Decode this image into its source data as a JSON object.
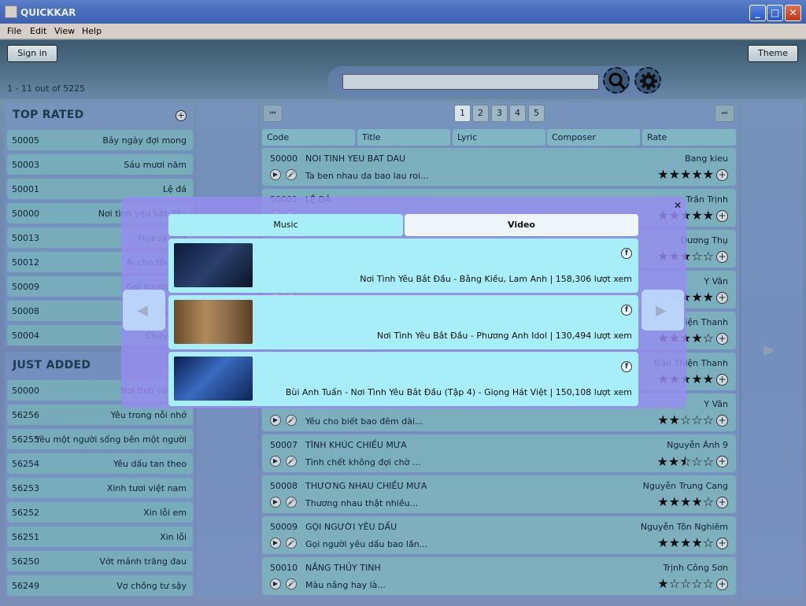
{
  "window": {
    "title": "QUICKKAR",
    "minimize": "_",
    "maximize": "□",
    "close": "✕"
  },
  "menu": [
    "File",
    "Edit",
    "View",
    "Help"
  ],
  "header": {
    "sign_in": "Sign in",
    "theme": "Theme",
    "result_count": "1 - 11 out of 5225",
    "search_placeholder": ""
  },
  "icons": {
    "search": "search-icon",
    "settings": "gear-icon"
  },
  "top_rated": {
    "heading": "TOP RATED",
    "add": "+",
    "items": [
      {
        "code": "50005",
        "title": "Bảy ngày đợi mong"
      },
      {
        "code": "50003",
        "title": "Sáu mươi năm"
      },
      {
        "code": "50001",
        "title": "Lệ đá"
      },
      {
        "code": "50000",
        "title": "Nơi tình yêu bắt đầu"
      },
      {
        "code": "50013",
        "title": "Họa sỹ nhà"
      },
      {
        "code": "50012",
        "title": "Ai cho tôi tình"
      },
      {
        "code": "50009",
        "title": "Gọi người yêu"
      },
      {
        "code": "50008",
        "title": "Thương"
      },
      {
        "code": "50004",
        "title": "Chuyện h"
      }
    ]
  },
  "just_added": {
    "heading": "JUST ADDED",
    "items": [
      {
        "code": "50000",
        "title": "Nơi tình yêu bắ"
      },
      {
        "code": "56256",
        "title": "Yêu trong nỗi nhớ"
      },
      {
        "code": "56255",
        "title": "Yêu một người sống bên một người"
      },
      {
        "code": "56254",
        "title": "Yêu dấu tan theo"
      },
      {
        "code": "56253",
        "title": "Xinh tươi việt nam"
      },
      {
        "code": "56252",
        "title": "Xin lỗi em"
      },
      {
        "code": "56251",
        "title": "Xin lỗi"
      },
      {
        "code": "56250",
        "title": "Vớt mảnh trăng đau"
      },
      {
        "code": "56249",
        "title": "Vợ chồng tư sậy"
      }
    ]
  },
  "pagination": {
    "first": "⏮",
    "last": "⏭",
    "pages": [
      "1",
      "2",
      "3",
      "4",
      "5"
    ],
    "current": "1"
  },
  "columns": [
    "Code",
    "Title",
    "Lyric",
    "Composer",
    "Rate"
  ],
  "songs": [
    {
      "code": "50000",
      "title": "NOI TINH YEU BAT DAU",
      "composer": "Bang kieu",
      "lyric": "Ta ben nhau da bao lau roi...",
      "rating": 5
    },
    {
      "code": "50001",
      "title": "LỆ ĐÁ",
      "composer": "Trần Trịnh",
      "lyric": "",
      "rating": 5
    },
    {
      "code": "",
      "title": "",
      "composer": "Dương Thụ",
      "lyric": "",
      "rating": 3
    },
    {
      "code": "",
      "title": "",
      "composer": "Y Vân",
      "lyric": "",
      "rating": 5
    },
    {
      "code": "",
      "title": "",
      "composer": "hiện Thanh",
      "lyric": "",
      "rating": 4
    },
    {
      "code": "",
      "title": "",
      "composer": "Trần Thiện Thanh",
      "lyric": "",
      "rating": 5
    },
    {
      "code": "",
      "title": "",
      "composer": "Y Vân",
      "lyric": "Yêu cho biết bao đêm dài...",
      "rating": 2
    },
    {
      "code": "50007",
      "title": "TÌNH KHÚC CHIỀU MƯA",
      "composer": "Nguyễn Ánh 9",
      "lyric": "Tình chết không đợi chờ ...",
      "rating": 2.5
    },
    {
      "code": "50008",
      "title": "THƯƠNG NHAU CHIỀU MƯA",
      "composer": "Nguyễn Trung Cang",
      "lyric": "Thương nhau thật nhiều...",
      "rating": 4
    },
    {
      "code": "50009",
      "title": "GỌI NGƯỜI YÊU DẤU",
      "composer": "Nguyễn Tôn Nghiêm",
      "lyric": "Gọi người yêu dấu bao lần...",
      "rating": 4
    },
    {
      "code": "50010",
      "title": "NẮNG THỦY TINH",
      "composer": "Trịnh Công Sơn",
      "lyric": "Màu nắng hay là...",
      "rating": 1
    }
  ],
  "popup": {
    "close": "✕",
    "tabs": [
      "Music",
      "Video"
    ],
    "active_tab": "Video",
    "prev": "◀",
    "next": "▶",
    "videos": [
      {
        "text": "Nơi Tình Yêu Bắt Đầu - Bằng Kiều, Lam Anh | 158,306 lượt xem",
        "share": "f"
      },
      {
        "text": "Nơi Tình Yêu Bắt Đầu - Phương Anh Idol | 130,494 lượt xem",
        "share": "f"
      },
      {
        "text": "Bùi Anh Tuấn - Nơi Tình Yêu Bắt Đầu (Tập 4) - Giọng Hát Việt | 150,108 lượt xem",
        "share": "f"
      }
    ]
  },
  "side_next": "▶"
}
